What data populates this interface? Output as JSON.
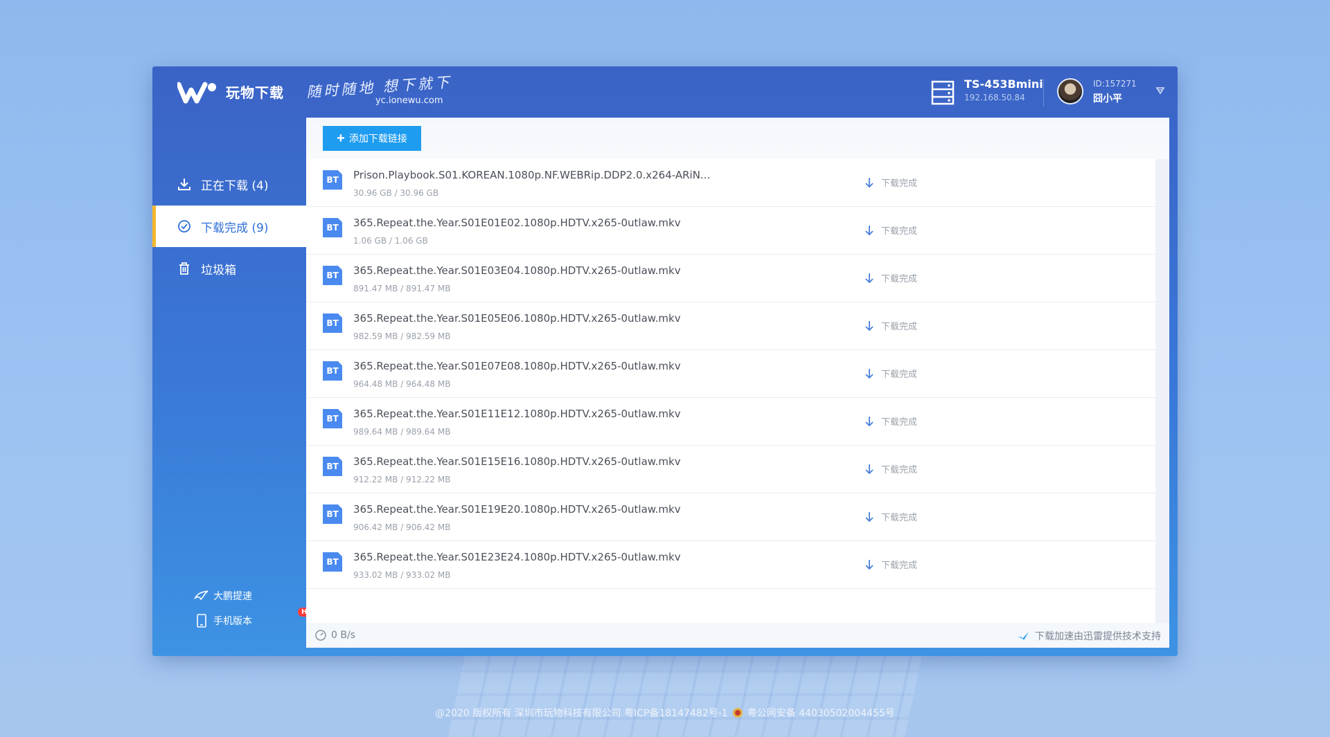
{
  "app": {
    "logo_text": "玩物下载",
    "slogan": "随时随地 想下就下",
    "site": "yc.ionewu.com"
  },
  "device": {
    "name": "TS-453Bmini",
    "ip": "192.168.50.84"
  },
  "user": {
    "id": "ID:157271",
    "name": "囧小平"
  },
  "sidebar": {
    "items": [
      {
        "label": "正在下载 (4)"
      },
      {
        "label": "下载完成 (9)"
      },
      {
        "label": "垃圾箱"
      }
    ],
    "extras": {
      "speedup": "大鹏提速",
      "mobile": "手机版本",
      "hot": "HOT"
    }
  },
  "toolbar": {
    "add_label": "添加下载链接"
  },
  "files": [
    {
      "name": "Prison.Playbook.S01.KOREAN.1080p.NF.WEBRip.DDP2.0.x264-ARiN...",
      "size": "30.96 GB / 30.96 GB",
      "status": "下载完成"
    },
    {
      "name": "365.Repeat.the.Year.S01E01E02.1080p.HDTV.x265-0utlaw.mkv",
      "size": "1.06 GB / 1.06 GB",
      "status": "下载完成"
    },
    {
      "name": "365.Repeat.the.Year.S01E03E04.1080p.HDTV.x265-0utlaw.mkv",
      "size": "891.47 MB / 891.47 MB",
      "status": "下载完成"
    },
    {
      "name": "365.Repeat.the.Year.S01E05E06.1080p.HDTV.x265-0utlaw.mkv",
      "size": "982.59 MB / 982.59 MB",
      "status": "下载完成"
    },
    {
      "name": "365.Repeat.the.Year.S01E07E08.1080p.HDTV.x265-0utlaw.mkv",
      "size": "964.48 MB / 964.48 MB",
      "status": "下载完成"
    },
    {
      "name": "365.Repeat.the.Year.S01E11E12.1080p.HDTV.x265-0utlaw.mkv",
      "size": "989.64 MB / 989.64 MB",
      "status": "下载完成"
    },
    {
      "name": "365.Repeat.the.Year.S01E15E16.1080p.HDTV.x265-0utlaw.mkv",
      "size": "912.22 MB / 912.22 MB",
      "status": "下载完成"
    },
    {
      "name": "365.Repeat.the.Year.S01E19E20.1080p.HDTV.x265-0utlaw.mkv",
      "size": "906.42 MB / 906.42 MB",
      "status": "下载完成"
    },
    {
      "name": "365.Repeat.the.Year.S01E23E24.1080p.HDTV.x265-0utlaw.mkv",
      "size": "933.02 MB / 933.02 MB",
      "status": "下载完成"
    }
  ],
  "file_badge": "BT",
  "footer": {
    "speed": "0 B/s",
    "powered": "下载加速由迅雷提供技术支持"
  },
  "copyright": {
    "left": "@2020 版权所有 深圳市玩物科技有限公司   粤ICP备18147482号-1",
    "right": "粤公网安备 44030502004455号"
  },
  "colors": {
    "accent": "#1e9cf0",
    "active_marker": "#f5b82e",
    "hot": "#ff3b3b"
  }
}
